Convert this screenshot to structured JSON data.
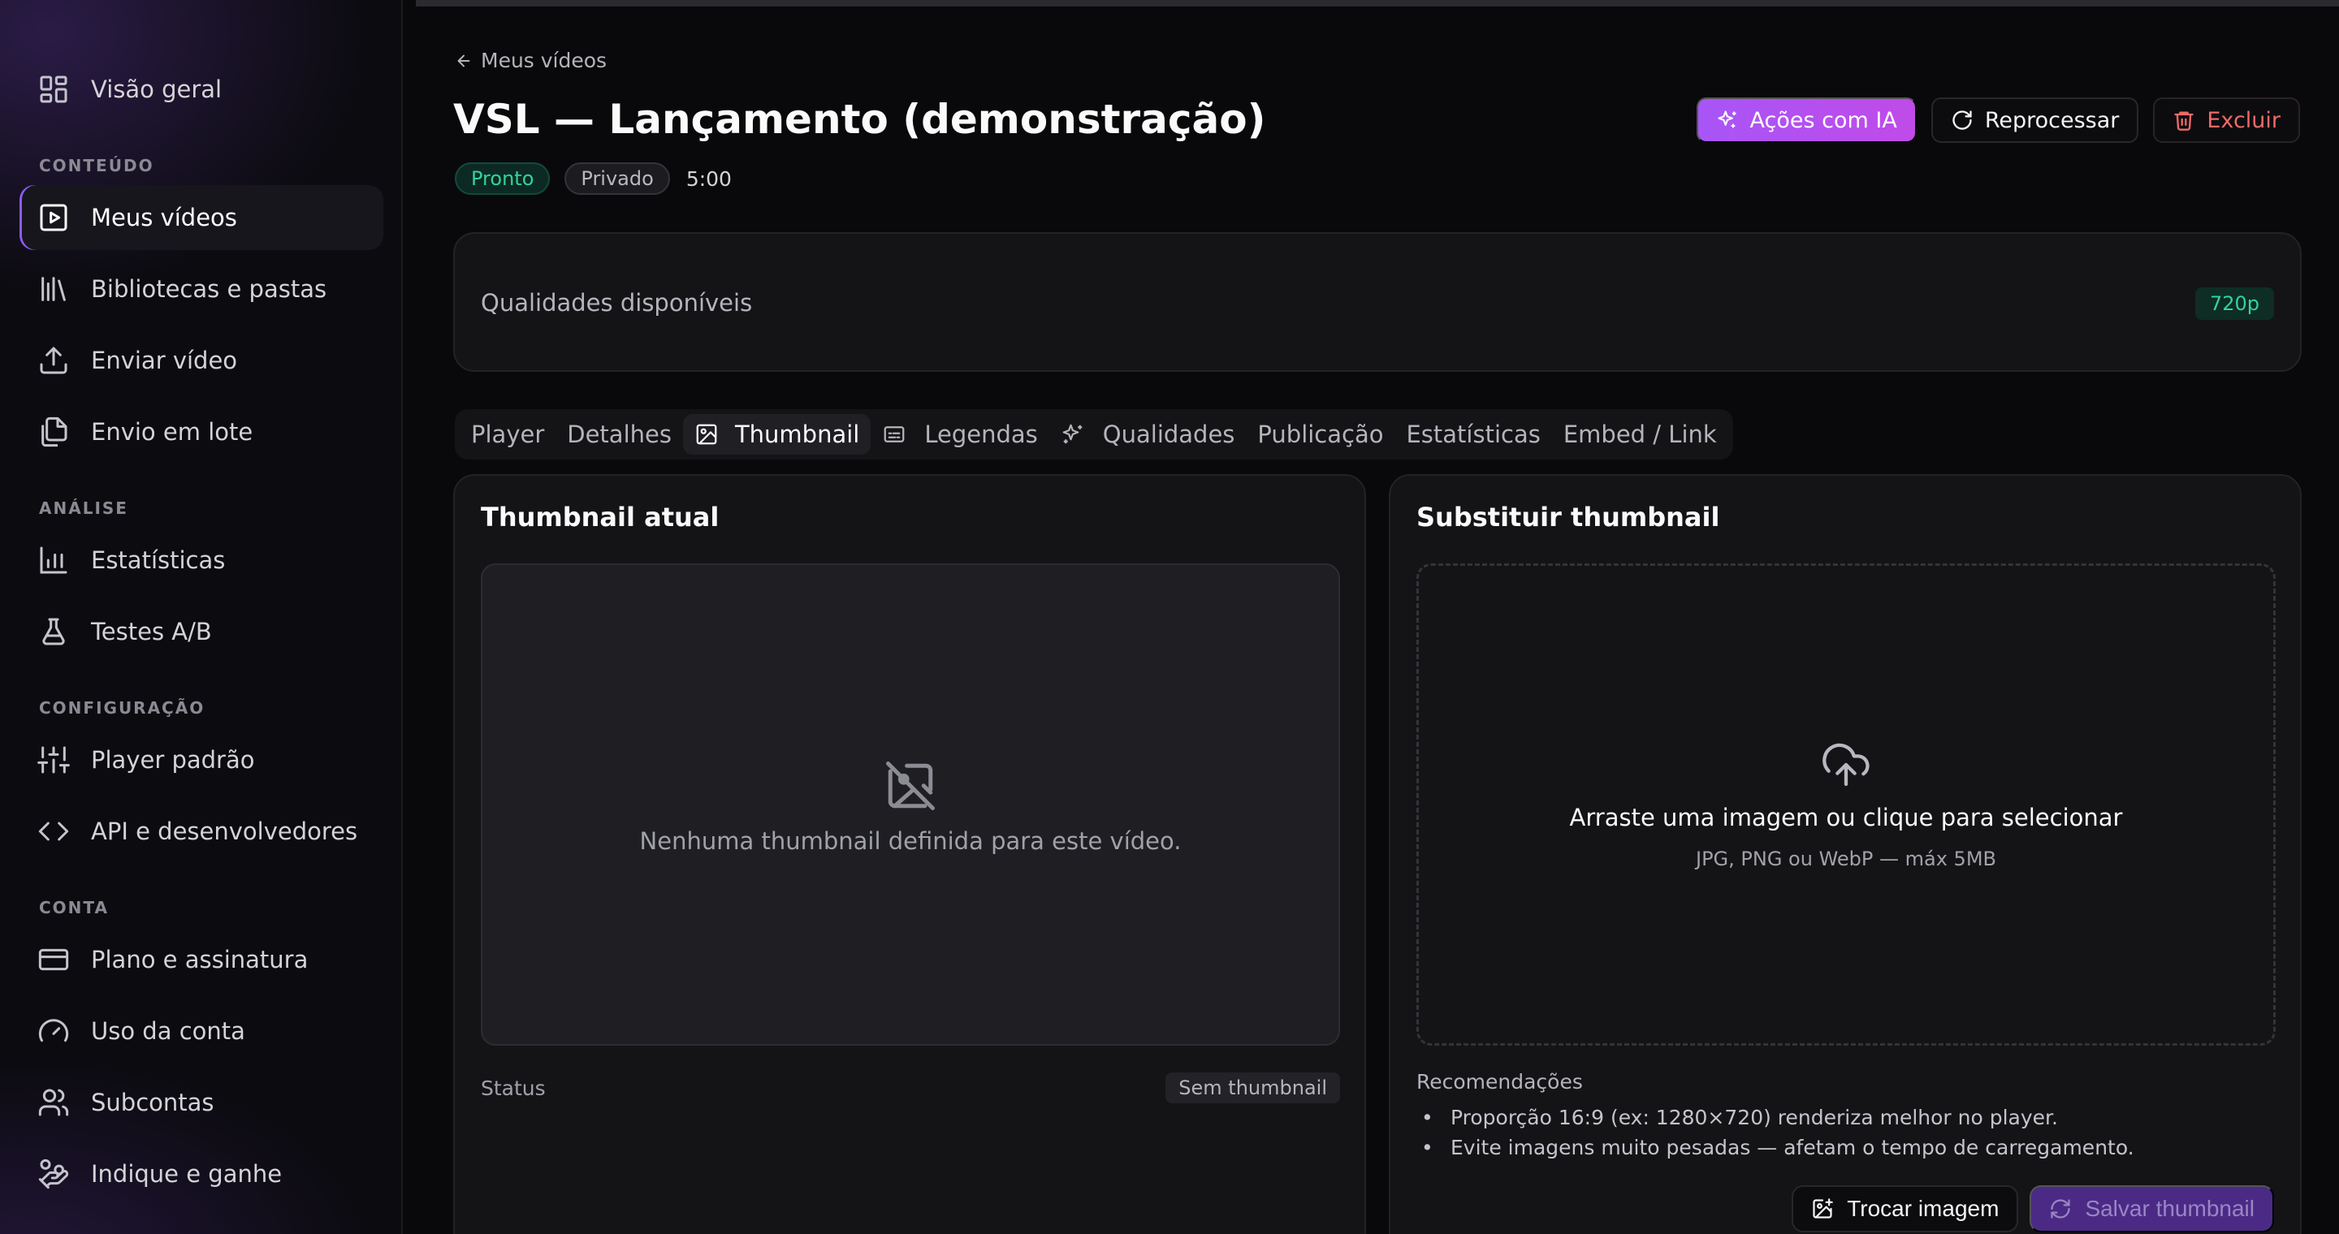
{
  "sidebar": {
    "items": {
      "overview": "Visão geral",
      "my_videos": "Meus vídeos",
      "libraries": "Bibliotecas e pastas",
      "upload": "Enviar vídeo",
      "batch": "Envio em lote",
      "stats": "Estatísticas",
      "ab_tests": "Testes A/B",
      "default_player": "Player padrão",
      "api": "API e desenvolvedores",
      "plan": "Plano e assinatura",
      "usage": "Uso da conta",
      "subaccounts": "Subcontas",
      "referral": "Indique e ganhe"
    },
    "sections": {
      "content": "CONTEÚDO",
      "analysis": "ANÁLISE",
      "config": "CONFIGURAÇÃO",
      "account": "CONTA"
    }
  },
  "header": {
    "back_label": "Meus vídeos",
    "title": "VSL — Lançamento (demonstração)",
    "status_badge": "Pronto",
    "visibility_badge": "Privado",
    "duration": "5:00",
    "actions": {
      "ai": "Ações com IA",
      "reprocess": "Reprocessar",
      "delete": "Excluir"
    }
  },
  "qualities": {
    "label": "Qualidades disponíveis",
    "badge": "720p"
  },
  "tabs": {
    "player": "Player",
    "details": "Detalhes",
    "thumbnail": "Thumbnail",
    "subtitles": "Legendas",
    "qualities": "Qualidades",
    "publishing": "Publicação",
    "stats": "Estatísticas",
    "embed": "Embed / Link"
  },
  "current_thumb": {
    "title": "Thumbnail atual",
    "empty_message": "Nenhuma thumbnail definida para este vídeo.",
    "status_label": "Status",
    "status_value": "Sem thumbnail"
  },
  "replace_thumb": {
    "title": "Substituir thumbnail",
    "drop_text": "Arraste uma imagem ou clique para selecionar",
    "drop_hint": "JPG, PNG ou WebP — máx 5MB",
    "rec_title": "Recomendações",
    "recommendations": [
      "Proporção 16:9 (ex: 1280×720) renderiza melhor no player.",
      "Evite imagens muito pesadas — afetam o tempo de carregamento."
    ],
    "swap_button": "Trocar imagem",
    "save_button": "Salvar thumbnail"
  },
  "colors": {
    "accent": "#a855f7",
    "success": "#34d399",
    "danger": "#f06969",
    "background": "#09090b"
  }
}
